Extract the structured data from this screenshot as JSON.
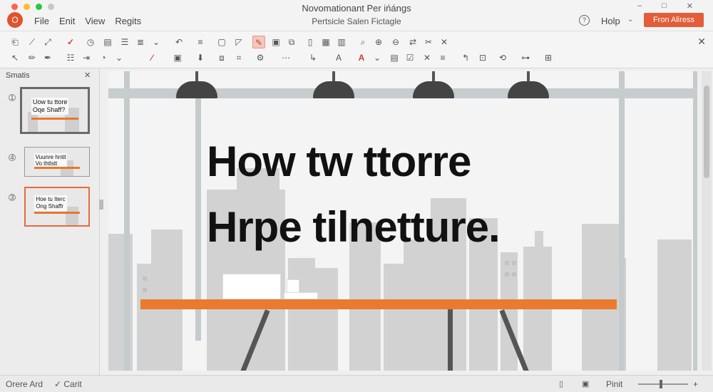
{
  "window": {
    "title": "Novomationant Per ińángs",
    "subtitle": "Pertsicle Salen Fictagle",
    "app_icon": "O",
    "controls": [
      "–",
      "□",
      "✕"
    ]
  },
  "menu": [
    "File",
    "Enit",
    "View",
    "Regits"
  ],
  "header": {
    "help_icon": "?",
    "help_label": "Holp",
    "help_caret": "⌄",
    "share_button": "Fron Aliress"
  },
  "panel": {
    "label": "Smatis",
    "close": "✕",
    "slides": [
      {
        "num": "1",
        "line1": "Uow tu ttore",
        "line2": "Oqe Shaff?"
      },
      {
        "num": "4",
        "line1": "Vuunre hntit",
        "line2": "Vo thtlstt"
      },
      {
        "num": "3",
        "line1": "Hoe tu Iterc",
        "line2": "Ong Shaffr"
      }
    ]
  },
  "slide": {
    "line1": "How tw ttorre",
    "line2": "Hrpe tilnetture."
  },
  "status": {
    "left": "Orere Ard",
    "check": "✓ Carit",
    "right": "Pinit"
  },
  "colors": {
    "accent": "#e35d38",
    "desk": "#ea7a2e",
    "traffic": [
      "#ff5f57",
      "#febc2e",
      "#28c840",
      "#c8c8c8"
    ]
  }
}
